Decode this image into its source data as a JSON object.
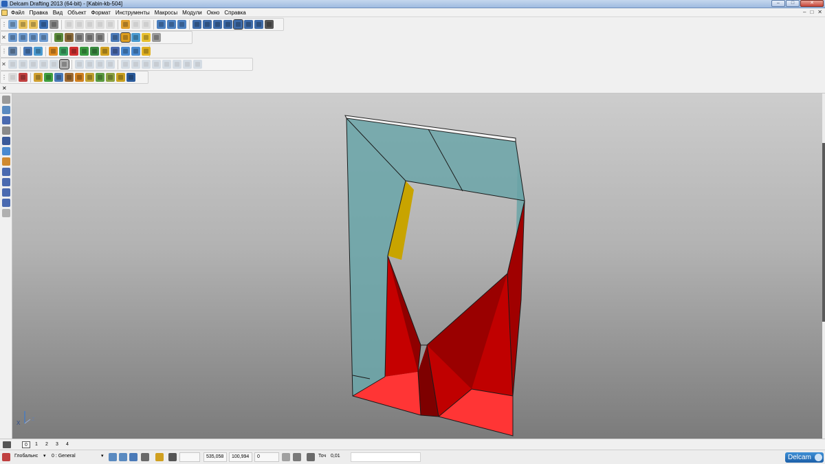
{
  "window": {
    "title": "Delcam Drafting 2013 (64-bit) - [Kabin-kb-504]",
    "buttons": [
      "–",
      "□",
      "✕"
    ]
  },
  "menu": {
    "items": [
      "Файл",
      "Правка",
      "Вид",
      "Объект",
      "Формат",
      "Инструменты",
      "Макросы",
      "Модули",
      "Окно",
      "Справка"
    ],
    "mdi_buttons": [
      "–",
      "□",
      "✕"
    ]
  },
  "toolbars": {
    "row1_grip": "⋮",
    "row2_grip": "✕",
    "row3_grip": "⋮",
    "row4_grip": "✕",
    "row5_grip": "⋮"
  },
  "icons": {
    "row1": [
      {
        "name": "new-icon",
        "color": "#7faad8"
      },
      {
        "name": "open-icon",
        "color": "#e8c25a"
      },
      {
        "name": "open-folder-icon",
        "color": "#e8c25a"
      },
      {
        "name": "save-icon",
        "color": "#3b6fb4"
      },
      {
        "name": "print-icon",
        "color": "#8a8a8a"
      },
      {
        "name": "cut-icon",
        "color": "#b8b8b8",
        "dim": true
      },
      {
        "name": "copy-icon",
        "color": "#b8b8b8",
        "dim": true
      },
      {
        "name": "paste-icon",
        "color": "#b8b8b8",
        "dim": true
      },
      {
        "name": "erase-icon",
        "color": "#b8b8b8",
        "dim": true
      },
      {
        "name": "delete-icon",
        "color": "#b8b8b8",
        "dim": true
      },
      {
        "name": "undo-icon",
        "color": "#e0a030"
      },
      {
        "name": "redo-icon",
        "color": "#b8b8b8",
        "dim": true
      },
      {
        "name": "snap-icon",
        "color": "#b8b8b8",
        "dim": true
      },
      {
        "name": "window-icon",
        "color": "#4a7fc0"
      },
      {
        "name": "layers-icon",
        "color": "#4a7fc0"
      },
      {
        "name": "layout-icon",
        "color": "#4a7fc0"
      },
      {
        "name": "measure-icon",
        "color": "#3d6aa8"
      },
      {
        "name": "trim-icon",
        "color": "#3d6aa8"
      },
      {
        "name": "circle-icon",
        "color": "#3d6aa8"
      },
      {
        "name": "curve-icon",
        "color": "#3d6aa8"
      },
      {
        "name": "text-icon",
        "color": "#3d6aa8",
        "pressed": true
      },
      {
        "name": "hatch-icon",
        "color": "#3d6aa8"
      },
      {
        "name": "arrow-icon",
        "color": "#3d6aa8"
      },
      {
        "name": "table-icon",
        "color": "#555555"
      }
    ],
    "row2": [
      {
        "name": "view-front-icon",
        "color": "#6e9bd0"
      },
      {
        "name": "view-iso-icon",
        "color": "#6e9bd0"
      },
      {
        "name": "view-top-icon",
        "color": "#6e9bd0"
      },
      {
        "name": "view-cube-icon",
        "color": "#6e9bd0"
      },
      {
        "name": "view-refresh-icon",
        "color": "#5a8a3a"
      },
      {
        "name": "pan-icon",
        "color": "#8a6a3a"
      },
      {
        "name": "zoom-icon",
        "color": "#8a8a8a"
      },
      {
        "name": "zoom-in-icon",
        "color": "#8a8a8a"
      },
      {
        "name": "zoom-out-icon",
        "color": "#8a8a8a"
      },
      {
        "name": "globe-icon",
        "color": "#4a7ab8"
      },
      {
        "name": "shade-icon",
        "color": "#e0a020",
        "pressed": true
      },
      {
        "name": "solid-icon",
        "color": "#4a9ad0"
      },
      {
        "name": "light-icon",
        "color": "#e8c030"
      },
      {
        "name": "settings-icon",
        "color": "#9a9a9a"
      }
    ],
    "row3": [
      {
        "name": "model-icon",
        "color": "#6a8ab0"
      },
      {
        "name": "doc-icon",
        "color": "#4a7ab8"
      },
      {
        "name": "wire-icon",
        "color": "#4a9ad0"
      },
      {
        "name": "surface-icon",
        "color": "#e08a20"
      },
      {
        "name": "shell-icon",
        "color": "#3aa060"
      },
      {
        "name": "ball-icon",
        "color": "#d03030"
      },
      {
        "name": "cone-icon",
        "color": "#3a9a40"
      },
      {
        "name": "arrow-play-icon",
        "color": "#3a8a40"
      },
      {
        "name": "box-icon",
        "color": "#d0a020"
      },
      {
        "name": "multi-box-icon",
        "color": "#4a6ab0"
      },
      {
        "name": "transform-icon",
        "color": "#4a8ad0"
      },
      {
        "name": "mirror-icon",
        "color": "#4a8ad0"
      },
      {
        "name": "assembly-icon",
        "color": "#e0b020"
      }
    ],
    "row4": [
      {
        "name": "edit-1-icon",
        "color": "#9ab0c8",
        "dim": true
      },
      {
        "name": "edit-2-icon",
        "color": "#9ab0c8",
        "dim": true
      },
      {
        "name": "edit-3-icon",
        "color": "#9ab0c8",
        "dim": true
      },
      {
        "name": "edit-4-icon",
        "color": "#9ab0c8",
        "dim": true
      },
      {
        "name": "edit-5-icon",
        "color": "#9ab0c8",
        "dim": true
      },
      {
        "name": "frame-icon",
        "color": "#b0b0b0",
        "pressed": true
      },
      {
        "name": "wave-1-icon",
        "color": "#9ab0c8",
        "dim": true
      },
      {
        "name": "wave-2-icon",
        "color": "#9ab0c8",
        "dim": true
      },
      {
        "name": "wave-3-icon",
        "color": "#9ab0c8",
        "dim": true
      },
      {
        "name": "wave-4-icon",
        "color": "#9ab0c8",
        "dim": true
      },
      {
        "name": "curve-1-icon",
        "color": "#9ab0c8",
        "dim": true
      },
      {
        "name": "curve-2-icon",
        "color": "#9ab0c8",
        "dim": true
      },
      {
        "name": "curve-3-icon",
        "color": "#9ab0c8",
        "dim": true
      },
      {
        "name": "curve-4-icon",
        "color": "#9ab0c8",
        "dim": true
      },
      {
        "name": "curve-5-icon",
        "color": "#9ab0c8",
        "dim": true
      },
      {
        "name": "curve-6-icon",
        "color": "#9ab0c8",
        "dim": true
      },
      {
        "name": "curve-7-icon",
        "color": "#9ab0c8",
        "dim": true
      },
      {
        "name": "curve-8-icon",
        "color": "#9ab0c8",
        "dim": true
      }
    ],
    "row5": [
      {
        "name": "pick-icon",
        "color": "#b0b0b0",
        "dim": true
      },
      {
        "name": "axis-icon",
        "color": "#c04040"
      },
      {
        "name": "block-1-icon",
        "color": "#d0a030"
      },
      {
        "name": "block-2-icon",
        "color": "#40a040"
      },
      {
        "name": "block-3-icon",
        "color": "#4a7ab8"
      },
      {
        "name": "block-4-icon",
        "color": "#a06a30"
      },
      {
        "name": "block-5-icon",
        "color": "#d08020"
      },
      {
        "name": "block-6-icon",
        "color": "#c0a030"
      },
      {
        "name": "block-7-icon",
        "color": "#5a9a40"
      },
      {
        "name": "block-8-icon",
        "color": "#8aa040"
      },
      {
        "name": "block-9-icon",
        "color": "#c8a020"
      },
      {
        "name": "block-10-icon",
        "color": "#2a5a9a"
      }
    ],
    "left": [
      {
        "name": "select-icon",
        "color": "#9a9a9a"
      },
      {
        "name": "layers-panel-icon",
        "color": "#5a8ac0"
      },
      {
        "name": "text-tool-icon",
        "color": "#4a6ab0"
      },
      {
        "name": "zoom-tool-icon",
        "color": "#8a8a8a"
      },
      {
        "name": "arc-icon",
        "color": "#3a5a9a"
      },
      {
        "name": "weld-icon",
        "color": "#4a8ad0"
      },
      {
        "name": "person-icon",
        "color": "#d08a30"
      },
      {
        "name": "pin-icon",
        "color": "#4a6ab0"
      },
      {
        "name": "rotate-icon",
        "color": "#4a6ab0"
      },
      {
        "name": "triangle-icon",
        "color": "#4a6ab0"
      },
      {
        "name": "dimension-icon",
        "color": "#4a6ab0"
      },
      {
        "name": "weld-grey-icon",
        "color": "#b0b0b0"
      }
    ]
  },
  "tabs": {
    "items": [
      "0",
      "1",
      "2",
      "3",
      "4"
    ],
    "active": 0
  },
  "status": {
    "coordinate_system": "Глобальнс",
    "layer": "0  : General",
    "x": "535,058",
    "y": "100,994",
    "z": "0",
    "tolerance_label": "Точ",
    "tolerance_value": "0,01",
    "brand": "Delcam"
  },
  "axis_labels": {
    "x": "X",
    "z": "Z"
  },
  "colors": {
    "glass": "#6ba5a8",
    "red_face": "#c50000",
    "bright_red": "#ff3535",
    "gold": "#c8a400"
  }
}
